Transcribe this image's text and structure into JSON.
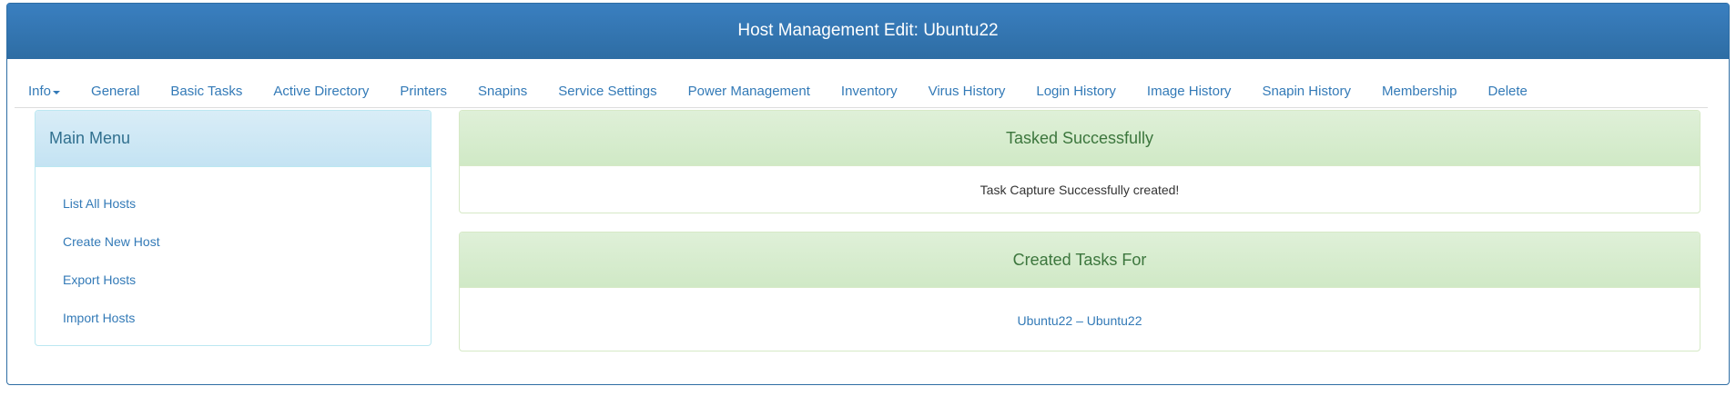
{
  "header": {
    "title": "Host Management Edit: Ubuntu22"
  },
  "nav": {
    "tabs": [
      {
        "label": "Info",
        "has_dropdown": true
      },
      {
        "label": "General"
      },
      {
        "label": "Basic Tasks"
      },
      {
        "label": "Active Directory"
      },
      {
        "label": "Printers"
      },
      {
        "label": "Snapins"
      },
      {
        "label": "Service Settings"
      },
      {
        "label": "Power Management"
      },
      {
        "label": "Inventory"
      },
      {
        "label": "Virus History"
      },
      {
        "label": "Login History"
      },
      {
        "label": "Image History"
      },
      {
        "label": "Snapin History"
      },
      {
        "label": "Membership"
      },
      {
        "label": "Delete"
      }
    ]
  },
  "main_menu": {
    "title": "Main Menu",
    "items": [
      {
        "label": "List All Hosts"
      },
      {
        "label": "Create New Host"
      },
      {
        "label": "Export Hosts"
      },
      {
        "label": "Import Hosts"
      }
    ]
  },
  "tasked": {
    "title": "Tasked Successfully",
    "message": "Task Capture Successfully created!"
  },
  "created": {
    "title": "Created Tasks For",
    "link": "Ubuntu22 – Ubuntu22"
  },
  "colors": {
    "primary": "#337ab7",
    "header_bg": "#2e6da4",
    "info_bg": "#d9edf7",
    "info_text": "#31708f",
    "success_bg": "#dff0d8",
    "success_text": "#3c763d"
  },
  "icons": {
    "dropdown": "caret-down-icon"
  }
}
